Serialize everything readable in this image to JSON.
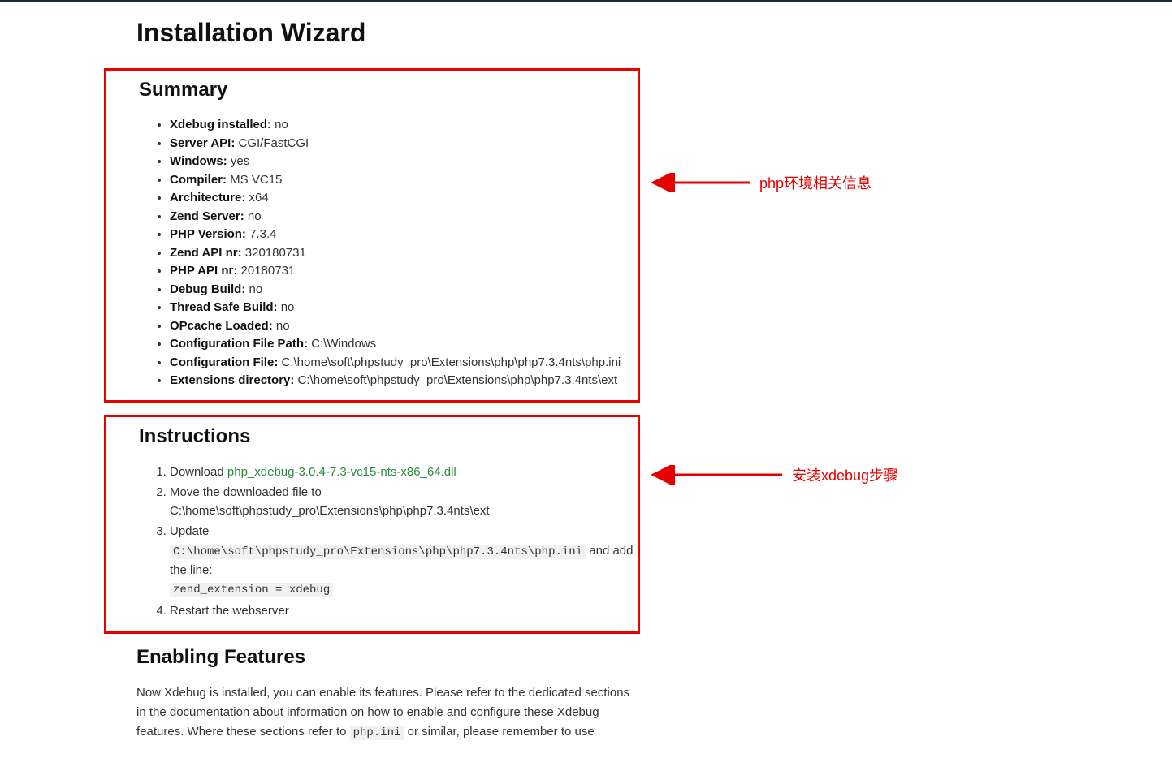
{
  "page": {
    "title": "Installation Wizard"
  },
  "summary": {
    "heading": "Summary",
    "items": [
      {
        "k": "Xdebug installed:",
        "v": "no"
      },
      {
        "k": "Server API:",
        "v": "CGI/FastCGI"
      },
      {
        "k": "Windows:",
        "v": "yes"
      },
      {
        "k": "Compiler:",
        "v": "MS VC15"
      },
      {
        "k": "Architecture:",
        "v": "x64"
      },
      {
        "k": "Zend Server:",
        "v": "no"
      },
      {
        "k": "PHP Version:",
        "v": "7.3.4"
      },
      {
        "k": "Zend API nr:",
        "v": "320180731"
      },
      {
        "k": "PHP API nr:",
        "v": "20180731"
      },
      {
        "k": "Debug Build:",
        "v": "no"
      },
      {
        "k": "Thread Safe Build:",
        "v": "no"
      },
      {
        "k": "OPcache Loaded:",
        "v": "no"
      },
      {
        "k": "Configuration File Path:",
        "v": "C:\\Windows"
      },
      {
        "k": "Configuration File:",
        "v": "C:\\home\\soft\\phpstudy_pro\\Extensions\\php\\php7.3.4nts\\php.ini"
      },
      {
        "k": "Extensions directory:",
        "v": "C:\\home\\soft\\phpstudy_pro\\Extensions\\php\\php7.3.4nts\\ext"
      }
    ]
  },
  "instructions": {
    "heading": "Instructions",
    "download_prefix": "Download ",
    "download_link": "php_xdebug-3.0.4-7.3-vc15-nts-x86_64.dll",
    "move_text": "Move the downloaded file to C:\\home\\soft\\phpstudy_pro\\Extensions\\php\\php7.3.4nts\\ext",
    "update_word": "Update",
    "update_path": "C:\\home\\soft\\phpstudy_pro\\Extensions\\php\\php7.3.4nts\\php.ini",
    "update_tail": " and add the line:",
    "zend_line": "zend_extension = xdebug",
    "restart": "Restart the webserver"
  },
  "enabling": {
    "heading": "Enabling Features",
    "para_a": "Now Xdebug is installed, you can enable its features. Please refer to the dedicated sections in the documentation about information on how to enable and configure these Xdebug features. Where these sections refer to ",
    "php_ini": "php.ini",
    "para_b": " or similar, please remember to use"
  },
  "annotations": {
    "anno1": "php环境相关信息",
    "anno2": "安装xdebug步骤"
  }
}
